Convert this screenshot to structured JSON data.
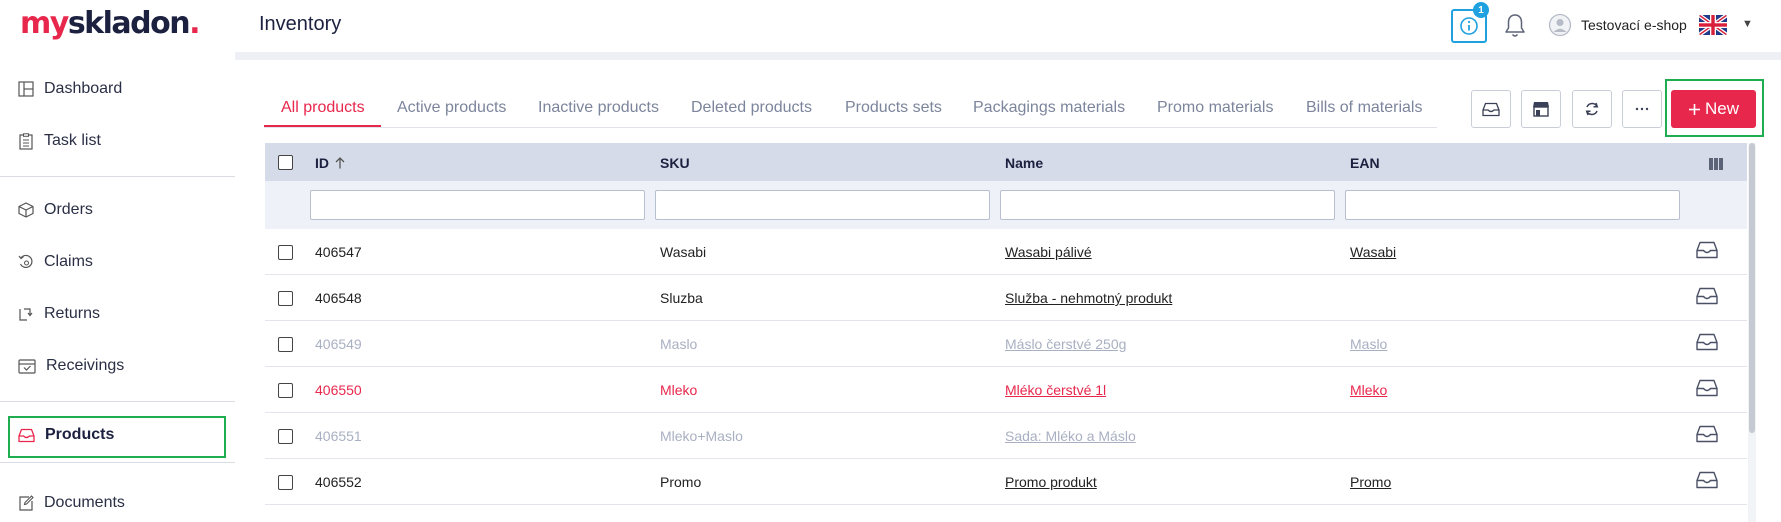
{
  "app": {
    "logo": {
      "part1": "my",
      "part2": "skladon",
      "part3": "."
    },
    "page_title": "Inventory",
    "info_badge": "1",
    "shop_name": "Testovací e-shop",
    "language": "english-flag-icon"
  },
  "sidebar": {
    "items": [
      {
        "label": "Dashboard",
        "icon": "dashboard-icon"
      },
      {
        "label": "Task list",
        "icon": "task-list-icon"
      },
      {
        "label": "Orders",
        "icon": "box-icon"
      },
      {
        "label": "Claims",
        "icon": "claims-icon"
      },
      {
        "label": "Returns",
        "icon": "returns-icon"
      },
      {
        "label": "Receivings",
        "icon": "receivings-icon"
      },
      {
        "label": "Products",
        "icon": "inbox-icon",
        "active": true
      },
      {
        "label": "Documents",
        "icon": "documents-icon"
      }
    ]
  },
  "tabs": [
    {
      "label": "All products",
      "active": true
    },
    {
      "label": "Active products"
    },
    {
      "label": "Inactive products"
    },
    {
      "label": "Deleted products"
    },
    {
      "label": "Products sets"
    },
    {
      "label": "Packagings materials"
    },
    {
      "label": "Promo materials"
    },
    {
      "label": "Bills of materials"
    }
  ],
  "toolbar": {
    "new_label": "New",
    "new_icon": "plus-icon"
  },
  "table": {
    "columns": {
      "id": "ID",
      "sku": "SKU",
      "name": "Name",
      "ean": "EAN"
    },
    "sort_icon": "arrow-up-icon",
    "rows": [
      {
        "id": "406547",
        "sku": "Wasabi",
        "name": "Wasabi pálivé",
        "ean": "Wasabi",
        "state": "normal"
      },
      {
        "id": "406548",
        "sku": "Sluzba",
        "name": "Služba - nehmotný produkt",
        "ean": "",
        "state": "normal"
      },
      {
        "id": "406549",
        "sku": "Maslo",
        "name": "Máslo čerstvé 250g",
        "ean": "Maslo",
        "state": "faded"
      },
      {
        "id": "406550",
        "sku": "Mleko",
        "name": "Mléko čerstvé 1l",
        "ean": "Mleko",
        "state": "red"
      },
      {
        "id": "406551",
        "sku": "Mleko+Maslo",
        "name": "Sada: Mléko a Máslo",
        "ean": "",
        "state": "faded"
      },
      {
        "id": "406552",
        "sku": "Promo",
        "name": "Promo produkt",
        "ean": "Promo",
        "state": "normal"
      }
    ]
  },
  "colors": {
    "brand": "#e8274c",
    "navy": "#1c2140",
    "info_blue": "#1fa1e0",
    "highlight_green": "#1fad4f",
    "faded_text": "#a9b0c2"
  }
}
